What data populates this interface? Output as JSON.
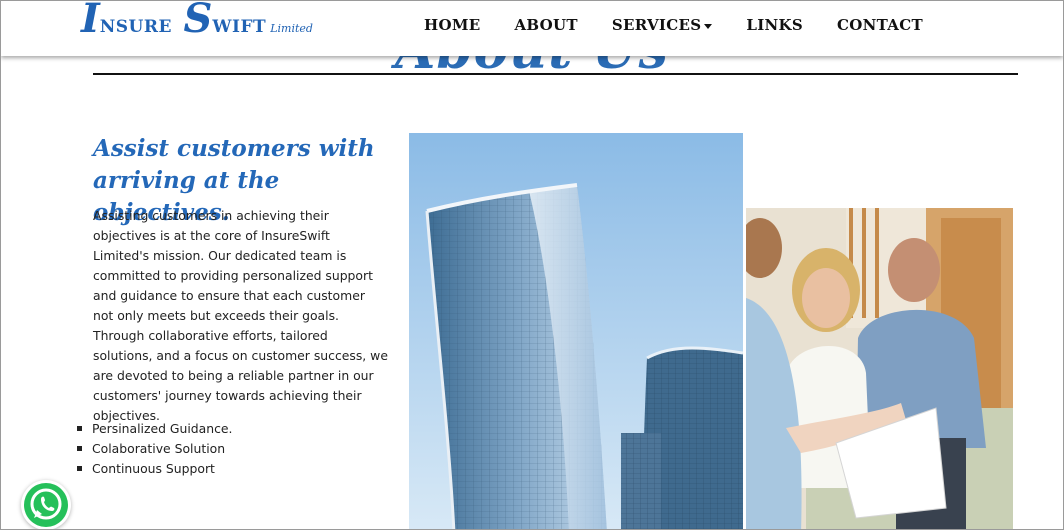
{
  "brand": {
    "initial1": "I",
    "rest1": "NSURE",
    "initial2": "S",
    "rest2": "WIFT",
    "suffix": "Limited"
  },
  "nav": {
    "items": [
      {
        "label": "HOME"
      },
      {
        "label": "ABOUT"
      },
      {
        "label": "SERVICES",
        "dropdown": true
      },
      {
        "label": "LINKS"
      },
      {
        "label": "CONTACT"
      }
    ]
  },
  "page": {
    "heading": "About Us",
    "subtitle": "Assist customers with arriving at the objectives.",
    "body": "Assisting customers in achieving their objectives is at the core of InsureSwift Limited's mission. Our dedicated team is committed to providing personalized support and guidance to ensure that each customer not only meets but exceeds their goals. Through collaborative efforts, tailored solutions, and a focus on customer success, we are devoted to being a reliable partner in our customers' journey towards achieving their objectives.",
    "features": [
      "Persinalized Guidance.",
      "Colaborative Solution",
      "Continuous Support"
    ]
  },
  "images": {
    "building": "glass-skyscraper-photo",
    "people": "advisor-meeting-couple-photo"
  },
  "floating": {
    "whatsapp_icon": "whatsapp-icon"
  },
  "colors": {
    "brand_blue": "#2163b4",
    "heading_blue": "#2468b8",
    "text": "#222222"
  }
}
